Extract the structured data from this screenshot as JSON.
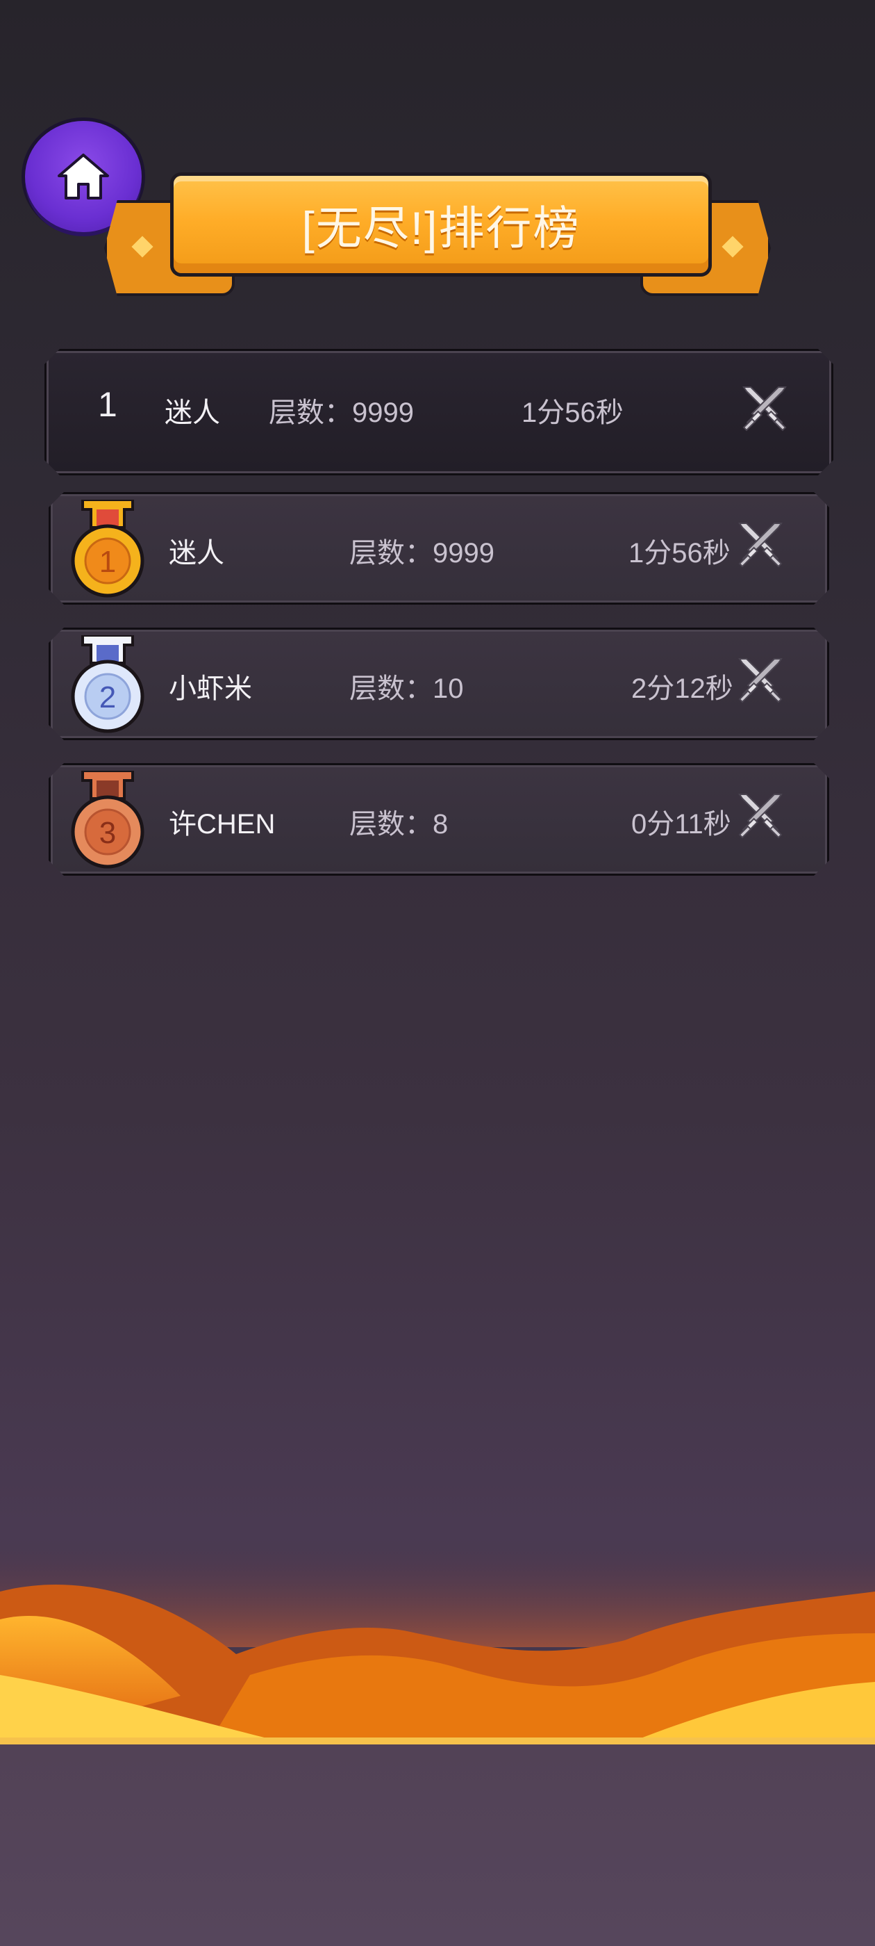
{
  "header": {
    "title": "[无尽!]排行榜",
    "home_icon": "home-icon"
  },
  "my_entry": {
    "rank": "1",
    "name": "迷人",
    "floors": "层数：9999",
    "time": "1分56秒",
    "icon": "crossed-swords-icon"
  },
  "leaderboard": [
    {
      "medal": "1",
      "medal_color": "#f5b21c",
      "name": "迷人",
      "floors": "层数：9999",
      "time": "1分56秒",
      "icon": "crossed-swords-icon"
    },
    {
      "medal": "2",
      "medal_color": "#b9cdf2",
      "name": "小虾米",
      "floors": "层数：10",
      "time": "2分12秒",
      "icon": "crossed-swords-icon"
    },
    {
      "medal": "3",
      "medal_color": "#e0774a",
      "name": "许CHEN",
      "floors": "层数：8",
      "time": "0分11秒",
      "icon": "crossed-swords-icon"
    }
  ],
  "colors": {
    "accent": "#ffad28",
    "home_button": "#6a2fd2",
    "background": "#2f2a34"
  }
}
